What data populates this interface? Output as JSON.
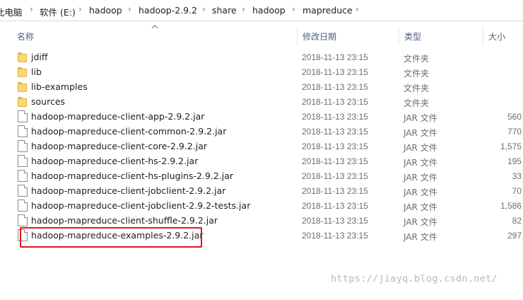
{
  "breadcrumb": [
    "此电脑",
    "软件 (E:)",
    "hadoop",
    "hadoop-2.9.2",
    "share",
    "hadoop",
    "mapreduce"
  ],
  "columns": {
    "name": "名称",
    "date": "修改日期",
    "type": "类型",
    "size": "大小"
  },
  "rows": [
    {
      "name": "jdiff",
      "date": "2018-11-13 23:15",
      "type": "文件夹",
      "size": "",
      "kind": "folder"
    },
    {
      "name": "lib",
      "date": "2018-11-13 23:15",
      "type": "文件夹",
      "size": "",
      "kind": "folder"
    },
    {
      "name": "lib-examples",
      "date": "2018-11-13 23:15",
      "type": "文件夹",
      "size": "",
      "kind": "folder"
    },
    {
      "name": "sources",
      "date": "2018-11-13 23:15",
      "type": "文件夹",
      "size": "",
      "kind": "folder"
    },
    {
      "name": "hadoop-mapreduce-client-app-2.9.2.jar",
      "date": "2018-11-13 23:15",
      "type": "JAR 文件",
      "size": "560",
      "kind": "file"
    },
    {
      "name": "hadoop-mapreduce-client-common-2.9.2.jar",
      "date": "2018-11-13 23:15",
      "type": "JAR 文件",
      "size": "770",
      "kind": "file"
    },
    {
      "name": "hadoop-mapreduce-client-core-2.9.2.jar",
      "date": "2018-11-13 23:15",
      "type": "JAR 文件",
      "size": "1,575",
      "kind": "file"
    },
    {
      "name": "hadoop-mapreduce-client-hs-2.9.2.jar",
      "date": "2018-11-13 23:15",
      "type": "JAR 文件",
      "size": "195",
      "kind": "file"
    },
    {
      "name": "hadoop-mapreduce-client-hs-plugins-2.9.2.jar",
      "date": "2018-11-13 23:15",
      "type": "JAR 文件",
      "size": "33",
      "kind": "file"
    },
    {
      "name": "hadoop-mapreduce-client-jobclient-2.9.2.jar",
      "date": "2018-11-13 23:15",
      "type": "JAR 文件",
      "size": "70",
      "kind": "file"
    },
    {
      "name": "hadoop-mapreduce-client-jobclient-2.9.2-tests.jar",
      "date": "2018-11-13 23:15",
      "type": "JAR 文件",
      "size": "1,586",
      "kind": "file"
    },
    {
      "name": "hadoop-mapreduce-client-shuffle-2.9.2.jar",
      "date": "2018-11-13 23:15",
      "type": "JAR 文件",
      "size": "82",
      "kind": "file"
    },
    {
      "name": "hadoop-mapreduce-examples-2.9.2.jar",
      "date": "2018-11-13 23:15",
      "type": "JAR 文件",
      "size": "297",
      "kind": "file"
    }
  ],
  "highlighted_row": 12,
  "highlight_color": "#e8131b",
  "watermark": "https://jiayq.blog.csdn.net/"
}
